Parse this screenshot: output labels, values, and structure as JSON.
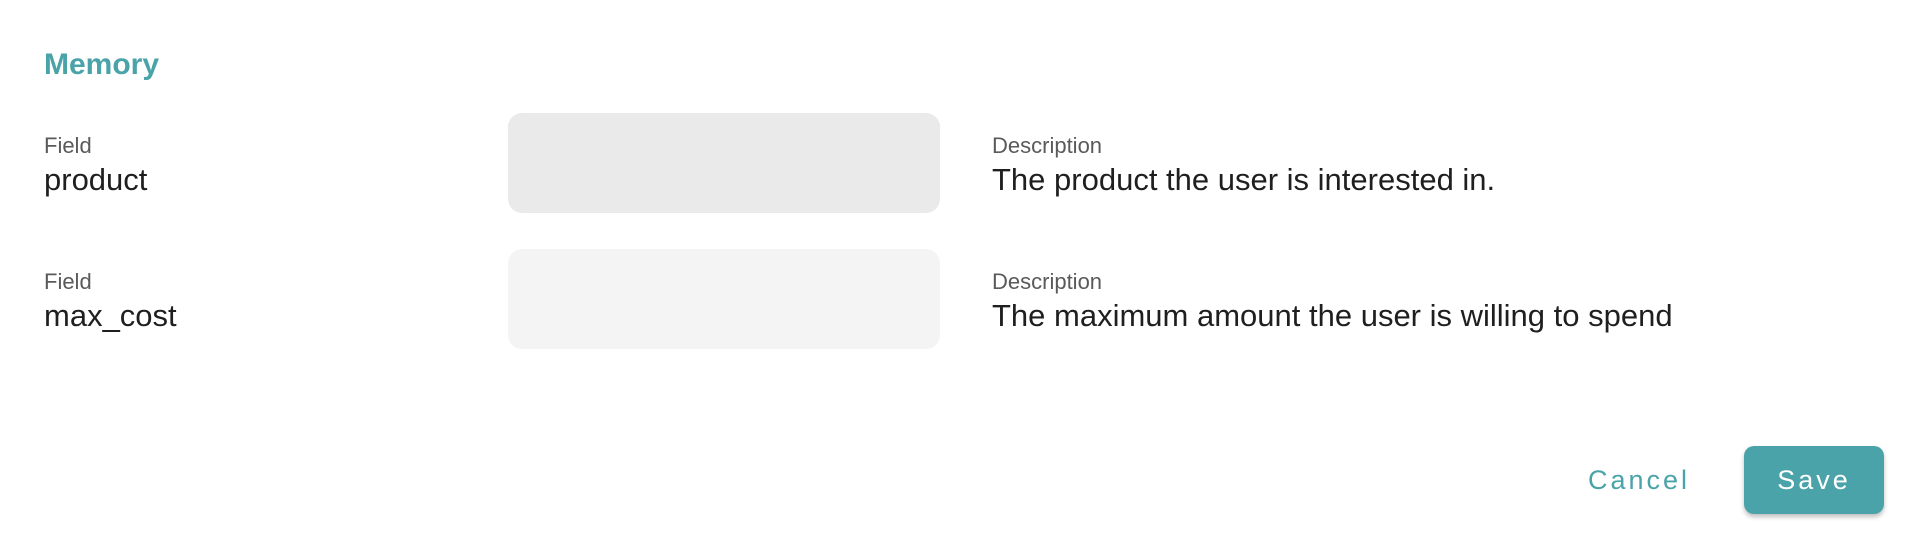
{
  "dialog": {
    "title": "Memory"
  },
  "fields": [
    {
      "field_label": "Field",
      "field_name": "product",
      "value": "",
      "description_label": "Description",
      "description": "The product the user is interested in."
    },
    {
      "field_label": "Field",
      "field_name": "max_cost",
      "value": "",
      "description_label": "Description",
      "description": "The maximum amount the user is willing to spend"
    }
  ],
  "actions": {
    "cancel_label": "Cancel",
    "save_label": "Save"
  },
  "colors": {
    "accent": "#4aa3a8",
    "input_bg_active": "#eaeaea",
    "input_bg": "#f4f4f4"
  }
}
